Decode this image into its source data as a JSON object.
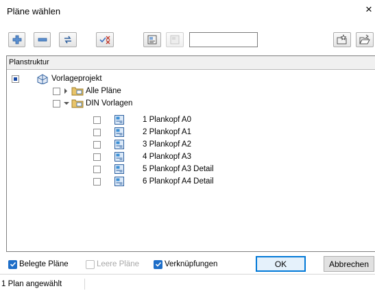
{
  "window": {
    "title": "Pläne wählen",
    "close_symbol": "×"
  },
  "toolbar": {
    "buttons": [
      {
        "name": "expand-all",
        "icon": "plus-icon"
      },
      {
        "name": "collapse-all",
        "icon": "minus-icon"
      },
      {
        "name": "refresh",
        "icon": "swap-icon"
      },
      {
        "name": "deselect-all",
        "icon": "clear-selection-icon"
      },
      {
        "name": "create-plan",
        "icon": "new-plan-icon"
      },
      {
        "name": "plan-disabled",
        "icon": "plan-icon"
      },
      {
        "name": "favorite-save",
        "icon": "star-folder-icon"
      },
      {
        "name": "favorite-open",
        "icon": "open-folder-icon"
      }
    ],
    "name_input_value": ""
  },
  "tree": {
    "header": "Planstruktur",
    "root": {
      "label": "Vorlageprojekt"
    },
    "folders": [
      {
        "label": "Alle Pläne",
        "expanded": false
      },
      {
        "label": "DIN Vorlagen",
        "expanded": true
      }
    ],
    "plans": [
      {
        "label": "1 Plankopf A0"
      },
      {
        "label": "2 Plankopf A1"
      },
      {
        "label": "3 Plankopf A2"
      },
      {
        "label": "4 Plankopf A3"
      },
      {
        "label": "5 Plankopf A3 Detail"
      },
      {
        "label": "6 Plankopf A4 Detail"
      }
    ]
  },
  "options": {
    "belegte": {
      "label": "Belegte Pläne",
      "checked": true
    },
    "leere": {
      "label": "Leere Pläne",
      "checked": false,
      "disabled": true
    },
    "verknuepfungen": {
      "label": "Verknüpfungen",
      "checked": true
    }
  },
  "buttons": {
    "ok": "OK",
    "cancel": "Abbrechen"
  },
  "status": {
    "text": "1 Plan angewählt"
  },
  "colors": {
    "accent": "#1e6ec8",
    "folder": "#e8c46a",
    "plan_icon": "#3a8fd6"
  }
}
